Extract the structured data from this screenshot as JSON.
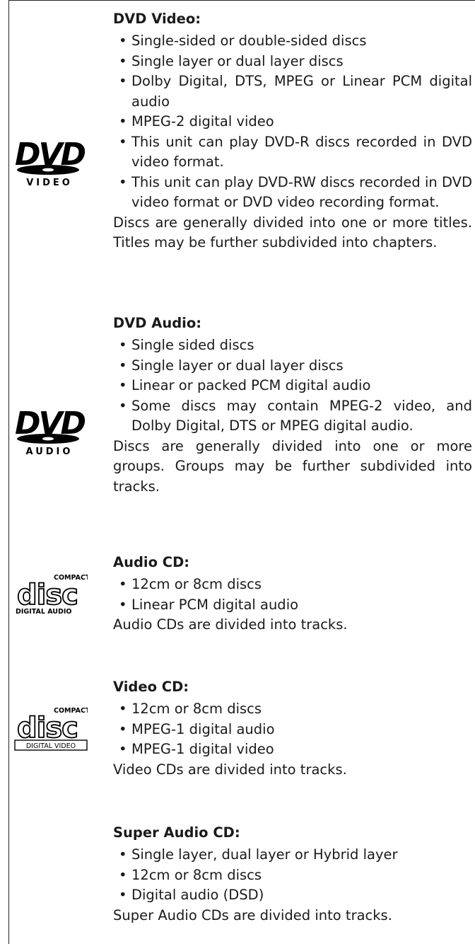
{
  "sections": [
    {
      "heading": "DVD Video:",
      "logo_text": "VIDEO",
      "bullets": [
        "Single-sided or double-sided discs",
        "Single layer or dual layer discs",
        "Dolby Digital, DTS, MPEG or Linear PCM digital audio",
        "MPEG-2 digital video",
        "This unit can play DVD-R discs recorded in DVD video format.",
        "This unit can play DVD-RW discs recorded in DVD video format or DVD video recording format."
      ],
      "description": "Discs are generally divided into one or more titles. Titles may be further subdivided into chapters."
    },
    {
      "heading": "DVD Audio:",
      "logo_text": "AUDIO",
      "bullets": [
        "Single sided discs",
        "Single layer or dual layer discs",
        "Linear or packed PCM digital audio",
        "Some discs may contain MPEG-2 video, and Dolby Digital, DTS or MPEG digital audio."
      ],
      "description": "Discs are generally divided into one or more groups. Groups may be further subdivided into tracks."
    },
    {
      "heading": "Audio CD:",
      "logo_top": "COMPACT",
      "logo_bottom": "DIGITAL AUDIO",
      "bullets": [
        "12cm or 8cm discs",
        "Linear PCM digital audio"
      ],
      "description": "Audio CDs are divided into tracks."
    },
    {
      "heading": "Video CD:",
      "logo_top": "COMPACT",
      "logo_bottom": "DIGITAL VIDEO",
      "bullets": [
        "12cm or 8cm discs",
        "MPEG-1 digital audio",
        "MPEG-1 digital video"
      ],
      "description": "Video CDs are divided into tracks."
    },
    {
      "heading": "Super Audio CD:",
      "bullets": [
        "Single layer, dual layer or Hybrid layer",
        "12cm or 8cm discs",
        "Digital audio (DSD)"
      ],
      "description": "Super Audio CDs are divided into tracks."
    }
  ]
}
